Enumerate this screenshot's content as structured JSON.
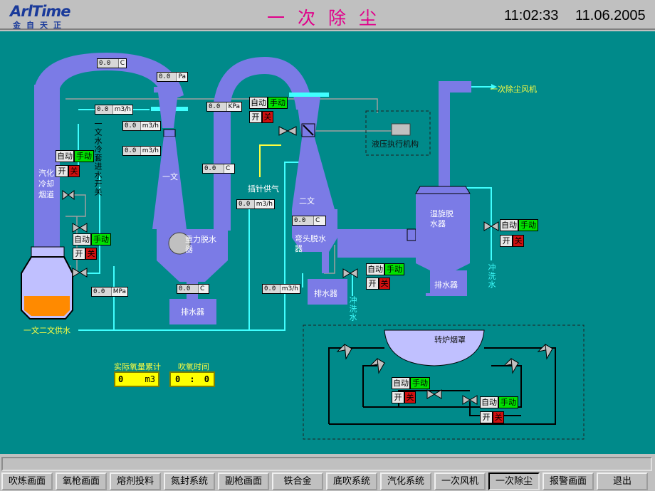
{
  "header": {
    "logo_brand": "ArlTime",
    "logo_sub": "金自天正",
    "title": "一次除尘",
    "time": "11:02:33",
    "date": "11.06.2005"
  },
  "labels": {
    "fan": "一次除尘风机",
    "hydraulic": "液压执行机构",
    "nozzle_supply": "插针供气",
    "evap_flue": "汽化冷却烟道",
    "wen1": "一文",
    "wen1_valve": "一文水冷套进水开关",
    "gravity": "重力脱水器",
    "wen2": "二文",
    "elbow": "弯头脱水器",
    "drain1": "排水器",
    "drain2": "排水器",
    "drain3": "排水器",
    "swirl": "湿旋脱水器",
    "water_supply": "一文二文供水",
    "flush1": "冲洗水",
    "flush2": "冲洗水",
    "hood": "转炉烟罩",
    "oxygen_total": "实际氧量累计",
    "blow_time": "吹氧时间"
  },
  "controls": {
    "auto": "自动",
    "manual": "手动",
    "on": "开",
    "off": "关"
  },
  "readouts": {
    "temp_top": {
      "value": "0.0",
      "unit": "C"
    },
    "pressure_top": {
      "value": "0.0",
      "unit": "Pa"
    },
    "flow_1": {
      "value": "0.0",
      "unit": "m3/h"
    },
    "flow_2": {
      "value": "0.0",
      "unit": "m3/h"
    },
    "flow_3": {
      "value": "0.0",
      "unit": "m3/h"
    },
    "kpa": {
      "value": "0.0",
      "unit": "KPa"
    },
    "temp_mid": {
      "value": "0.0",
      "unit": "C"
    },
    "flow_4": {
      "value": "0.0",
      "unit": "m3/h"
    },
    "temp_wen2": {
      "value": "0.0",
      "unit": "C"
    },
    "temp_gravity": {
      "value": "0.0",
      "unit": "C"
    },
    "mpa": {
      "value": "0.0",
      "unit": "MPa"
    },
    "flow_5": {
      "value": "0.0",
      "unit": "m3/h"
    }
  },
  "totals": {
    "oxygen": {
      "value": "0",
      "unit": "m3"
    },
    "time": {
      "min": "0",
      "sep": ":",
      "sec": "0"
    }
  },
  "nav": [
    "吹炼画面",
    "氧枪画面",
    "熔剂投料",
    "氮封系统",
    "副枪画面",
    "铁合金",
    "底吹系统",
    "汽化系统",
    "一次风机",
    "一次除尘",
    "报警画面",
    "退出"
  ],
  "nav_active": 9,
  "colors": {
    "background": "#008a8a",
    "vessel": "#7b7be6",
    "pipe_water": "#40ffff",
    "pipe_gas": "#ffff40",
    "title": "#e0008a"
  }
}
